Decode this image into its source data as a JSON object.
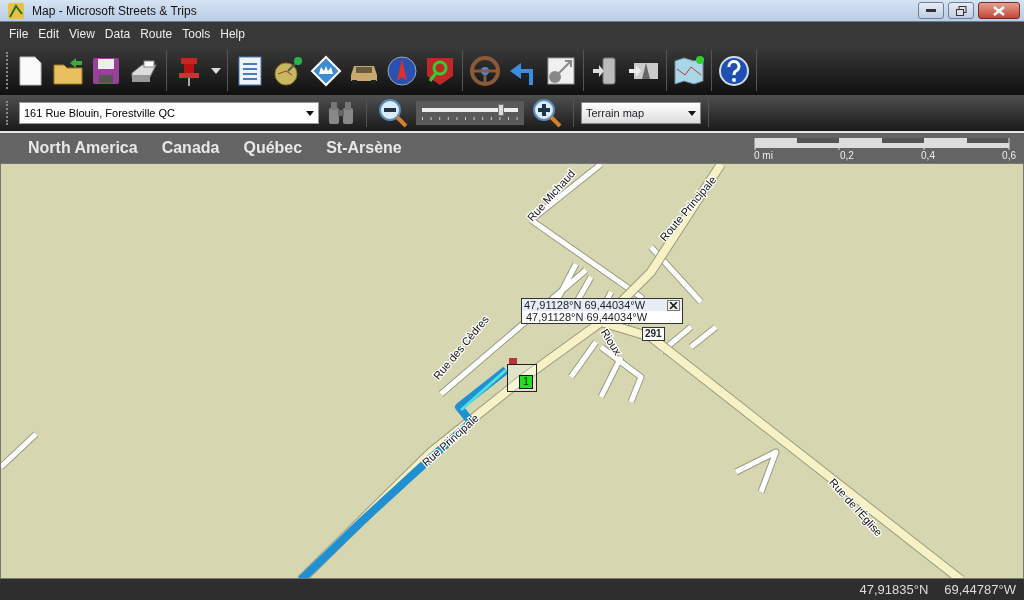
{
  "window": {
    "title": "Map - Microsoft Streets & Trips"
  },
  "menu": [
    {
      "label": "File"
    },
    {
      "label": "Edit"
    },
    {
      "label": "View"
    },
    {
      "label": "Data"
    },
    {
      "label": "Route"
    },
    {
      "label": "Tools"
    },
    {
      "label": "Help"
    }
  ],
  "address": {
    "value": "161 Rue Blouin, Forestville QC"
  },
  "zoom": {
    "level": 0.82
  },
  "map_style": {
    "value": "Terrain map"
  },
  "breadcrumb": [
    "North America",
    "Canada",
    "Québec",
    "St-Arsène"
  ],
  "scale": {
    "labels": [
      "0 mi",
      "0,2",
      "0,4",
      "0,6"
    ]
  },
  "map": {
    "street_labels": [
      "Rue Michaud",
      "Route Principale",
      "Rue des Cèdres",
      "Rioux",
      "Rue Principale",
      "Rue de l'Église"
    ],
    "route_shield": "291",
    "popup": {
      "title": "47,91128°N 69,44034°W",
      "text": "47,91128°N 69,44034°W"
    },
    "stop_marker": "1"
  },
  "status_bar": {
    "latitude": "47,91835°N",
    "longitude": "69,44787°W"
  }
}
